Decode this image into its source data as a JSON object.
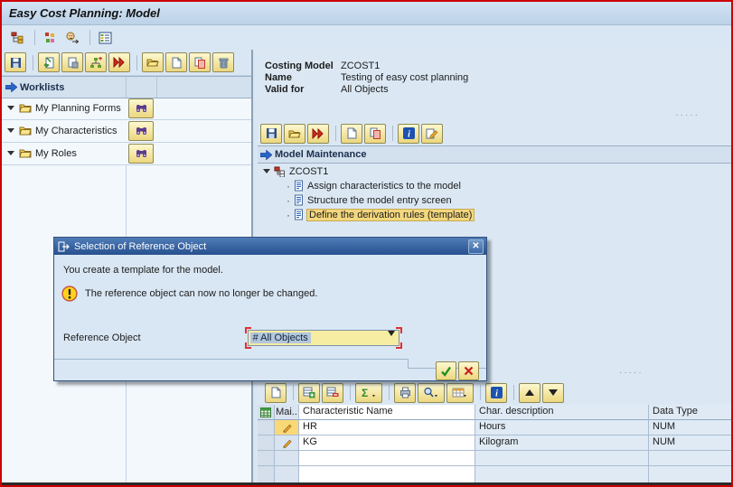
{
  "window": {
    "title": "Easy Cost Planning: Model"
  },
  "main_toolbar": {
    "icons": [
      "hierarchy-tree",
      "blocks",
      "assign-user",
      "table-view"
    ]
  },
  "left_panel": {
    "toolbar_icons": [
      "save",
      "create-entry",
      "display-entry",
      "hierarchy-insert",
      "fast-forward",
      "open",
      "new-document",
      "copy",
      "delete"
    ],
    "header": "Worklists",
    "items": [
      {
        "label": "My Planning Forms"
      },
      {
        "label": "My Characteristics"
      },
      {
        "label": "My Roles"
      }
    ],
    "find_icon": "binoculars"
  },
  "right_panel": {
    "info": {
      "costing_model_label": "Costing Model",
      "costing_model_value": "ZCOST1",
      "name_label": "Name",
      "name_value": "Testing of easy cost planning",
      "valid_for_label": "Valid for",
      "valid_for_value": "All Objects"
    },
    "toolbar_icons": [
      "save",
      "open",
      "fast-forward",
      "new-document",
      "copy",
      "info",
      "edit"
    ],
    "maintenance_header": "Model Maintenance",
    "tree": {
      "root": "ZCOST1",
      "items": [
        {
          "label": "Assign characteristics to the model",
          "highlighted": false
        },
        {
          "label": "Structure the model entry screen",
          "highlighted": false
        },
        {
          "label": "Define the derivation rules (template)",
          "highlighted": true
        }
      ]
    },
    "table": {
      "toolbar_icons": [
        "new-document",
        "insert-row",
        "delete-row",
        "sum",
        "print",
        "find",
        "grid-settings",
        "info",
        "move-up",
        "move-down"
      ],
      "columns": [
        "Mai..",
        "Characteristic Name",
        "Char. description",
        "Data Type"
      ],
      "rows": [
        {
          "name": "HR",
          "description": "Hours",
          "data_type": "NUM"
        },
        {
          "name": "KG",
          "description": "Kilogram",
          "data_type": "NUM"
        },
        {
          "name": "",
          "description": "",
          "data_type": ""
        },
        {
          "name": "",
          "description": "",
          "data_type": ""
        }
      ]
    }
  },
  "dialog": {
    "title": "Selection of Reference Object",
    "message": "You create a template for the model.",
    "warning": "The reference object can now no longer be changed.",
    "reference_object_label": "Reference Object",
    "reference_object_value": "# All Objects",
    "icons": [
      "exit",
      "close",
      "warning",
      "confirm",
      "cancel"
    ]
  },
  "colors": {
    "screen_border": "#cc0000",
    "tree_highlight": "#f3d77d",
    "dialog_title": "#2d5496",
    "combo_selection": "#b3c6db",
    "button_face": "#f2df8e",
    "cell_selected": "#fbd876"
  }
}
